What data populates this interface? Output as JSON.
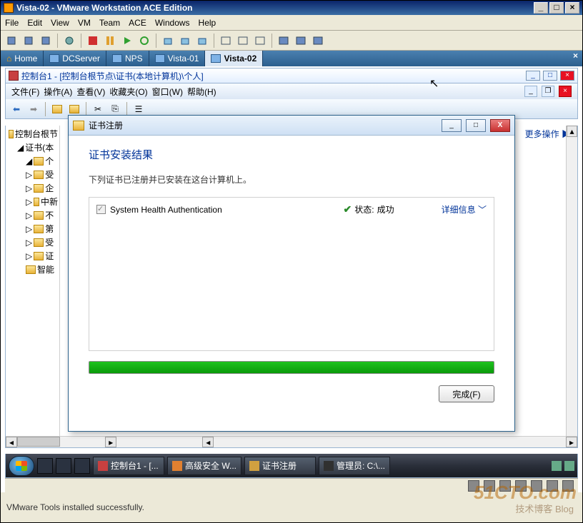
{
  "app": {
    "title": "Vista-02 - VMware Workstation ACE Edition"
  },
  "menu": {
    "items": [
      "File",
      "Edit",
      "View",
      "VM",
      "Team",
      "ACE",
      "Windows",
      "Help"
    ]
  },
  "tabs": {
    "home": "Home",
    "items": [
      "DCServer",
      "NPS",
      "Vista-01",
      "Vista-02"
    ],
    "active_index": 3
  },
  "mmc": {
    "title": "控制台1 - [控制台根节点\\证书(本地计算机)\\个人]",
    "menu": [
      "文件(F)",
      "操作(A)",
      "查看(V)",
      "收藏夹(O)",
      "窗口(W)",
      "帮助(H)"
    ],
    "tree_root": "控制台根节",
    "tree_cert": "证书(本",
    "tree_folders": [
      "个",
      "受",
      "企",
      "中新",
      "不",
      "第",
      "受",
      "证",
      "智能"
    ],
    "actions_label": "更多操作"
  },
  "dialog": {
    "title": "证书注册",
    "heading": "证书安装结果",
    "desc": "下列证书已注册并已安装在这台计算机上。",
    "cert_name": "System Health Authentication",
    "status_label": "状态:",
    "status_value": "成功",
    "detail": "详细信息",
    "finish": "完成(F)"
  },
  "taskbar": {
    "items": [
      {
        "label": "控制台1 - [...",
        "icon": "#c84040"
      },
      {
        "label": "高级安全 W...",
        "icon": "#e08030"
      },
      {
        "label": "证书注册",
        "icon": "#d0a040"
      },
      {
        "label": "管理员: C:\\...",
        "icon": "#303030"
      }
    ]
  },
  "footer": {
    "status": "VMware Tools installed successfully."
  },
  "watermark": {
    "main": "51CTO.com",
    "sub": "技术博客  Blog"
  }
}
